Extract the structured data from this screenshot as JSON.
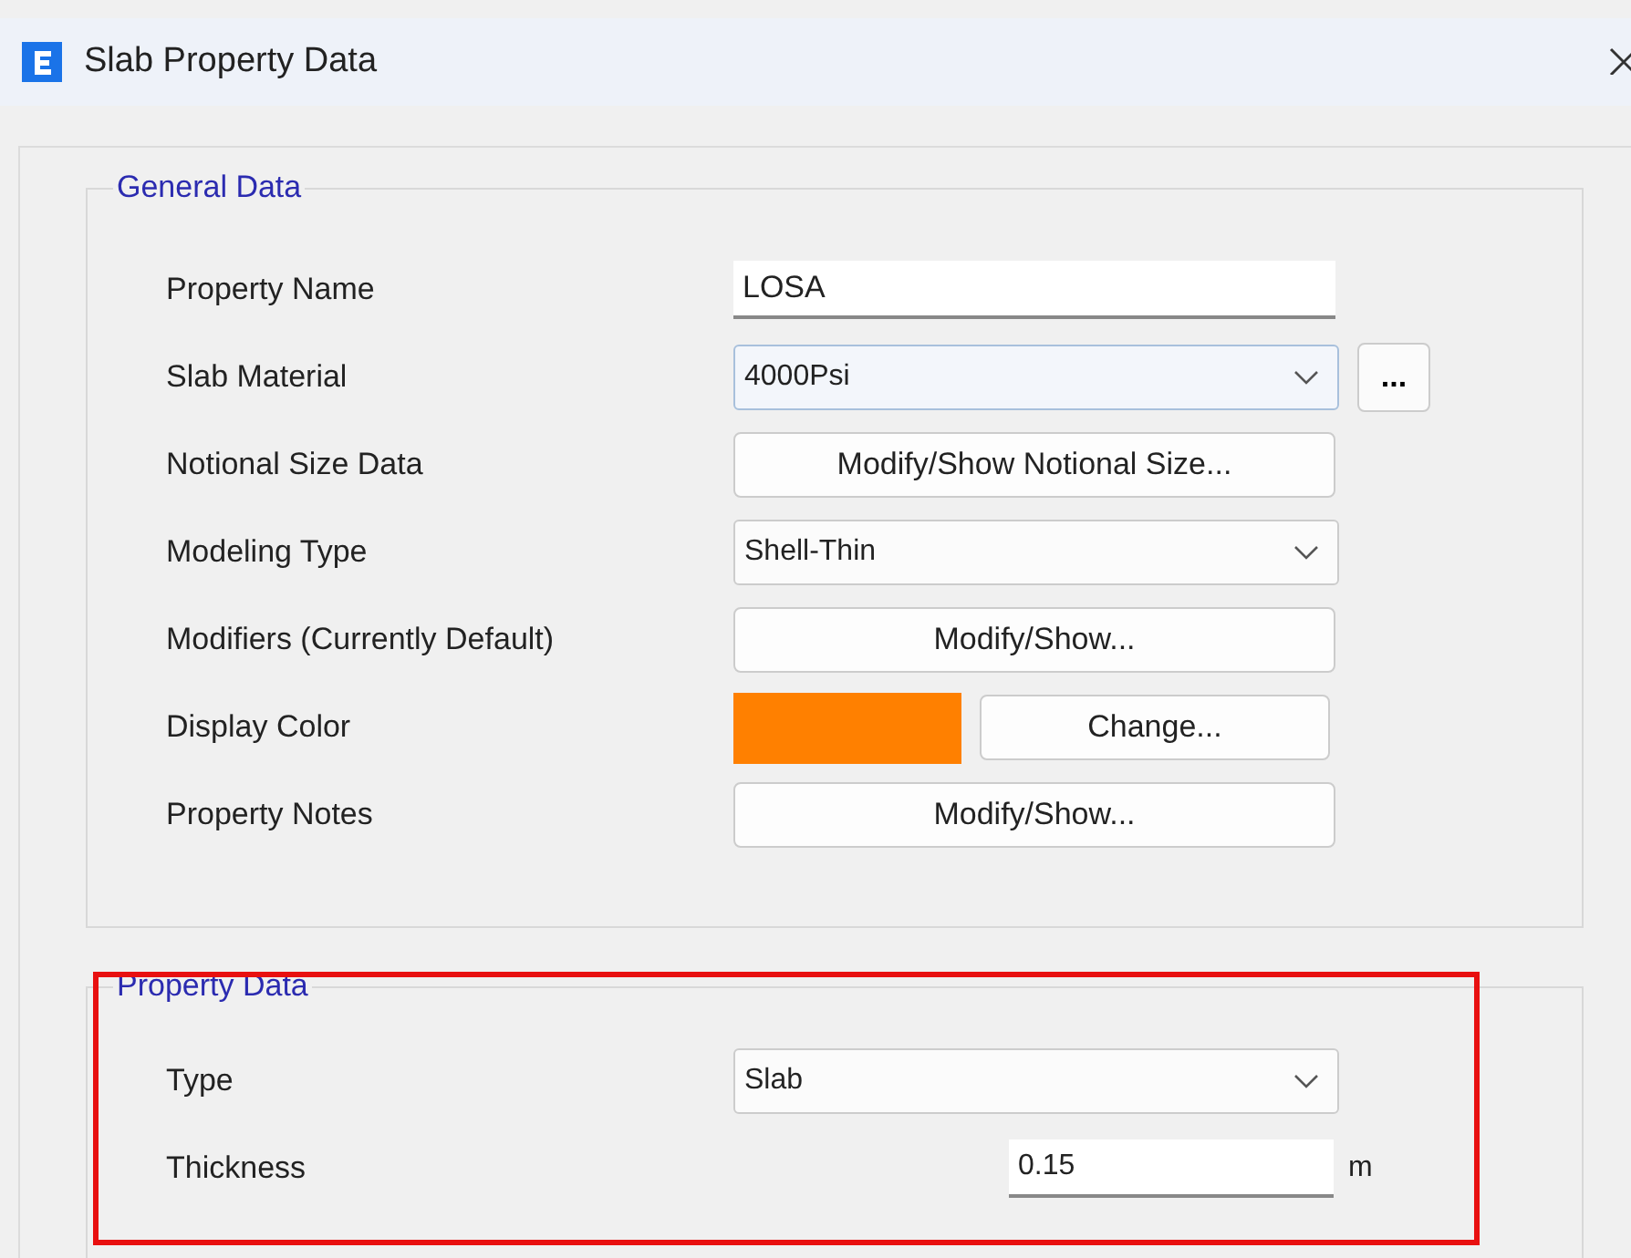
{
  "window": {
    "title": "Slab Property Data"
  },
  "general_data": {
    "legend": "General Data",
    "rows": [
      {
        "label": "Property Name",
        "control": {
          "kind": "text",
          "value": "LOSA"
        }
      },
      {
        "label": "Slab Material",
        "control": {
          "kind": "dropdown_more",
          "value": "4000Psi",
          "more": "..."
        }
      },
      {
        "label": "Notional Size Data",
        "control": {
          "kind": "button",
          "label": "Modify/Show Notional Size..."
        }
      },
      {
        "label": "Modeling Type",
        "control": {
          "kind": "dropdown",
          "value": "Shell-Thin"
        }
      },
      {
        "label": "Modifiers (Currently Default)",
        "control": {
          "kind": "button",
          "label": "Modify/Show..."
        }
      },
      {
        "label": "Display Color",
        "control": {
          "kind": "color",
          "color": "#ff8000",
          "label": "Change..."
        }
      },
      {
        "label": "Property Notes",
        "control": {
          "kind": "button",
          "label": "Modify/Show..."
        }
      }
    ]
  },
  "property_data": {
    "legend": "Property Data",
    "highlighted": true,
    "rows": [
      {
        "label": "Type",
        "control": {
          "kind": "dropdown",
          "value": "Slab"
        }
      },
      {
        "label": "Thickness",
        "control": {
          "kind": "number",
          "value": "0.15",
          "unit": "m"
        }
      }
    ]
  }
}
